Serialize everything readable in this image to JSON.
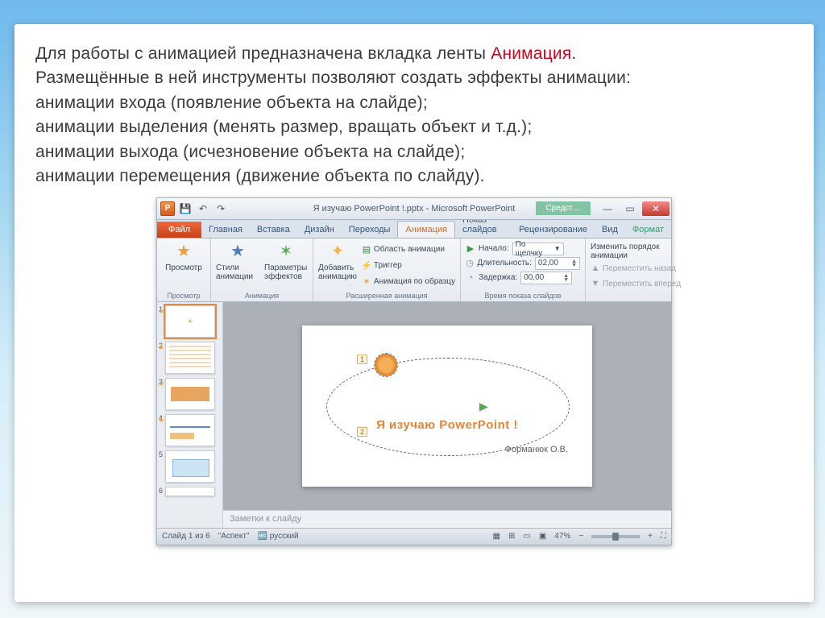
{
  "caption": {
    "l1_pre": "Для работы с анимацией предназначена вкладка ленты ",
    "l1_hl": "Анимация",
    "l1_post": ".",
    "l2": "Размещённые в ней инструменты позволяют создать  эффекты анимации:",
    "l3": "анимации входа (появление объекта на слайде);",
    "l4": "анимации выделения (менять размер, вращать объект и т.д.);",
    "l5": "анимации выхода (исчезновение объекта на слайде);",
    "l6": "анимации перемещения (движение объекта по слайду)."
  },
  "titlebar": {
    "title": "Я изучаю PowerPoint !.pptx  -  Microsoft PowerPoint",
    "context_label": "Средст…"
  },
  "tabs": {
    "file": "Файл",
    "home": "Главная",
    "insert": "Вставка",
    "design": "Дизайн",
    "transitions": "Переходы",
    "animations": "Анимация",
    "slideshow": "Показ слайдов",
    "review": "Рецензирование",
    "view": "Вид",
    "format": "Формат"
  },
  "ribbon": {
    "preview": "Просмотр",
    "preview_group": "Просмотр",
    "styles": "Стили анимации",
    "effect_opts": "Параметры эффектов",
    "animation_group": "Анимация",
    "add_anim": "Добавить анимацию",
    "anim_pane": "Область анимации",
    "trigger": "Триггер",
    "anim_painter": "Анимация по образцу",
    "advanced_group": "Расширенная анимация",
    "start_label": "Начало:",
    "start_value": "По щелчку",
    "duration_label": "Длительность:",
    "duration_value": "02,00",
    "delay_label": "Задержка:",
    "delay_value": "00,00",
    "timing_group": "Время показа слайдов",
    "reorder_title": "Изменить порядок анимации",
    "move_back": "Переместить назад",
    "move_fwd": "Переместить вперед"
  },
  "canvas": {
    "title": "Я изучаю PowerPoint !",
    "author": "Форманюк О.В.",
    "tag1": "1",
    "tag2": "2"
  },
  "notes": "Заметки к слайду",
  "status": {
    "slide_of": "Слайд 1 из 6",
    "theme": "\"Аспект\"",
    "lang": "русский",
    "zoom": "47%"
  },
  "thumbs": [
    "1",
    "2",
    "3",
    "4",
    "5",
    "6"
  ]
}
